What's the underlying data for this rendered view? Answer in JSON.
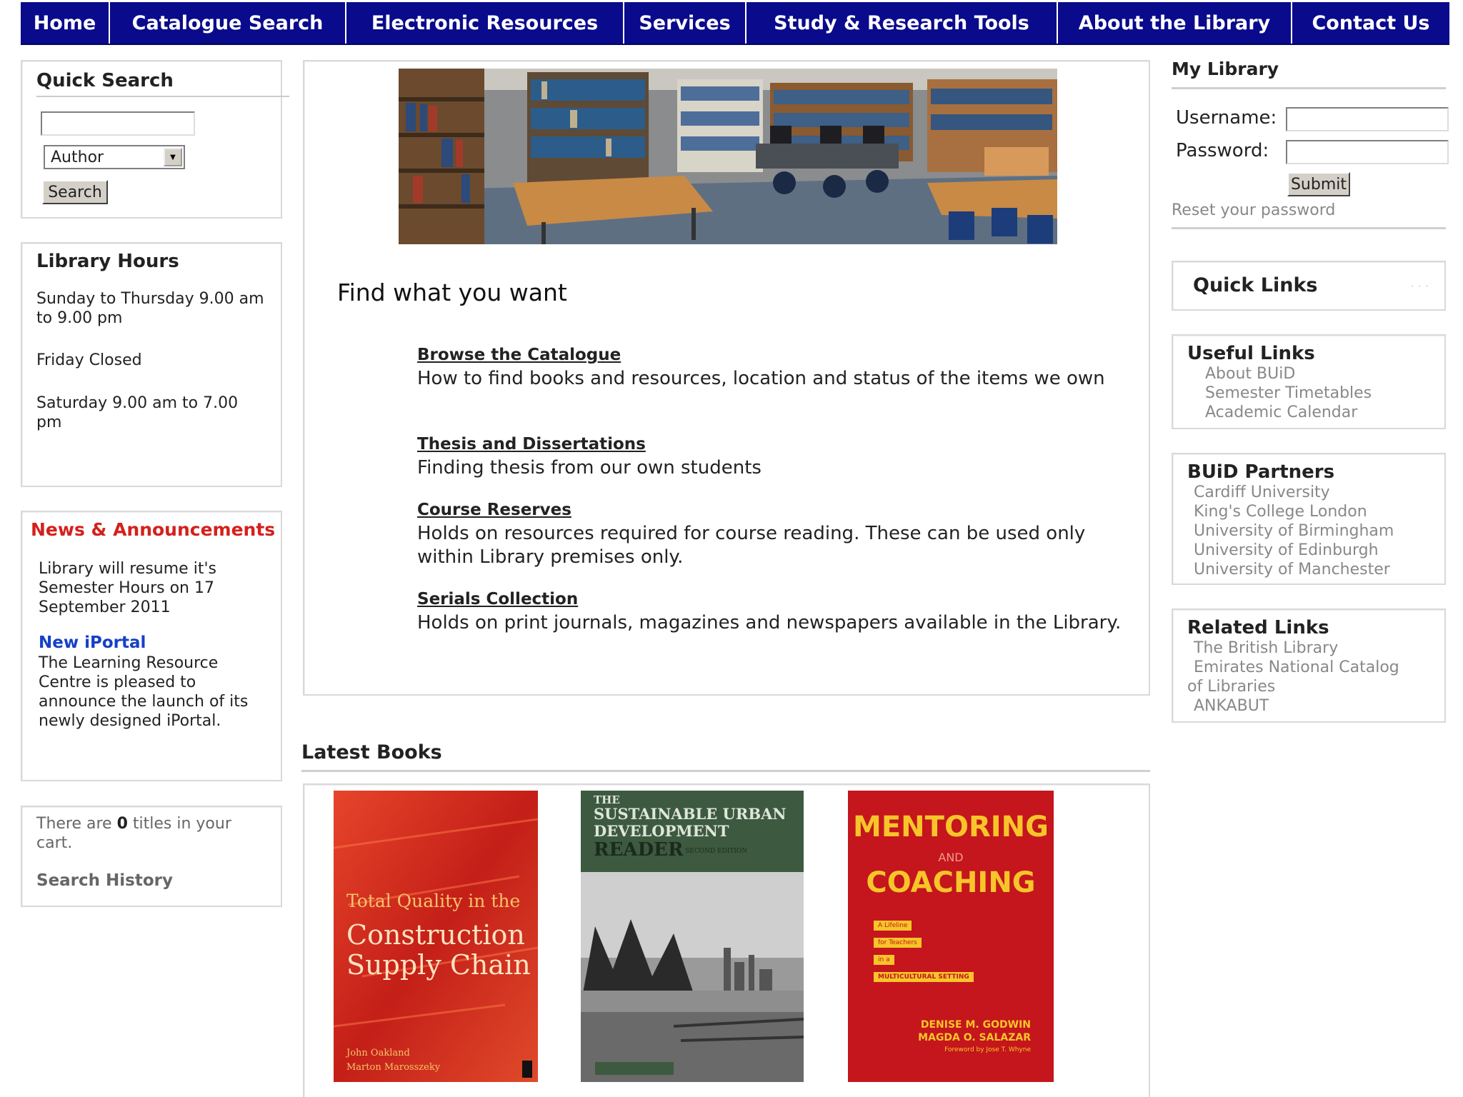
{
  "nav": {
    "items": [
      {
        "label": "Home"
      },
      {
        "label": "Catalogue Search"
      },
      {
        "label": "Electronic Resources"
      },
      {
        "label": "Services"
      },
      {
        "label": "Study & Research Tools"
      },
      {
        "label": "About the Library"
      },
      {
        "label": "Contact Us"
      }
    ],
    "bg_color": "#0a0a8c"
  },
  "quick_search": {
    "title": "Quick Search",
    "input_value": "",
    "select_value": "Author",
    "button_label": "Search"
  },
  "library_hours": {
    "title": "Library Hours",
    "lines": [
      "Sunday to Thursday 9.00 am to 9.00 pm",
      "Friday Closed",
      "Saturday 9.00 am to 7.00 pm"
    ]
  },
  "news": {
    "title": "News & Announcements",
    "title_color": "#d4201c",
    "item1_text": "Library will resume it's Semester Hours on 17 September 2011",
    "item2_title": "New iPortal",
    "item2_text": "The Learning Resource Centre is pleased to announce the launch of its newly designed iPortal."
  },
  "cart": {
    "prefix": "There are ",
    "count": "0",
    "suffix": " titles in your cart.",
    "search_history": "Search History"
  },
  "main": {
    "find_title": "Find what you want",
    "resources": [
      {
        "title": "Browse the Catalogue",
        "desc": "How to find books and resources, location and status of the items we own"
      },
      {
        "title": "Thesis and Dissertations",
        "desc": "Finding thesis from our own students"
      },
      {
        "title": "Course Reserves",
        "desc": "Holds on resources required for course reading. These can be used only within Library premises only."
      },
      {
        "title": "Serials Collection",
        "desc": "Holds on print journals, magazines and newspapers available in the Library."
      }
    ]
  },
  "latest_books": {
    "label": "Latest Books",
    "books": [
      {
        "title_line1": "Total Quality in the",
        "title_line2": "Construction",
        "title_line3": "Supply Chain",
        "authors": "John Oakland\nMarton Marosszeky"
      },
      {
        "top": "THE",
        "title_line1": "SUSTAINABLE URBAN",
        "title_line2": "DEVELOPMENT",
        "title_line3": "READER",
        "edition": "SECOND EDITION"
      },
      {
        "title_line1": "MENTORING",
        "and": "AND",
        "title_line2": "COACHING",
        "tags": [
          "A Lifeline",
          "for Teachers",
          "in a",
          "MULTICULTURAL SETTING"
        ],
        "authors_line1": "DENISE M. GODWIN",
        "authors_line2": "MAGDA O. SALAZAR",
        "foreword": "Foreword by Jose T. Whyne"
      }
    ]
  },
  "my_library": {
    "title": "My Library",
    "username_label": "Username:",
    "password_label": "Password:",
    "submit_label": "Submit",
    "reset_label": "Reset your password"
  },
  "quick_links": {
    "title": "Quick Links"
  },
  "useful_links": {
    "title": "Useful Links",
    "items": [
      "About BUiD",
      "Semester Timetables",
      "Academic Calendar"
    ]
  },
  "buid_partners": {
    "title": "BUiD Partners",
    "items": [
      "Cardiff University",
      "King's College London",
      "University of Birmingham",
      "University of Edinburgh",
      "University of Manchester"
    ]
  },
  "related_links": {
    "title": "Related Links",
    "items": [
      "The British Library",
      "Emirates National Catalog",
      "of Libraries",
      "ANKABUT"
    ]
  }
}
